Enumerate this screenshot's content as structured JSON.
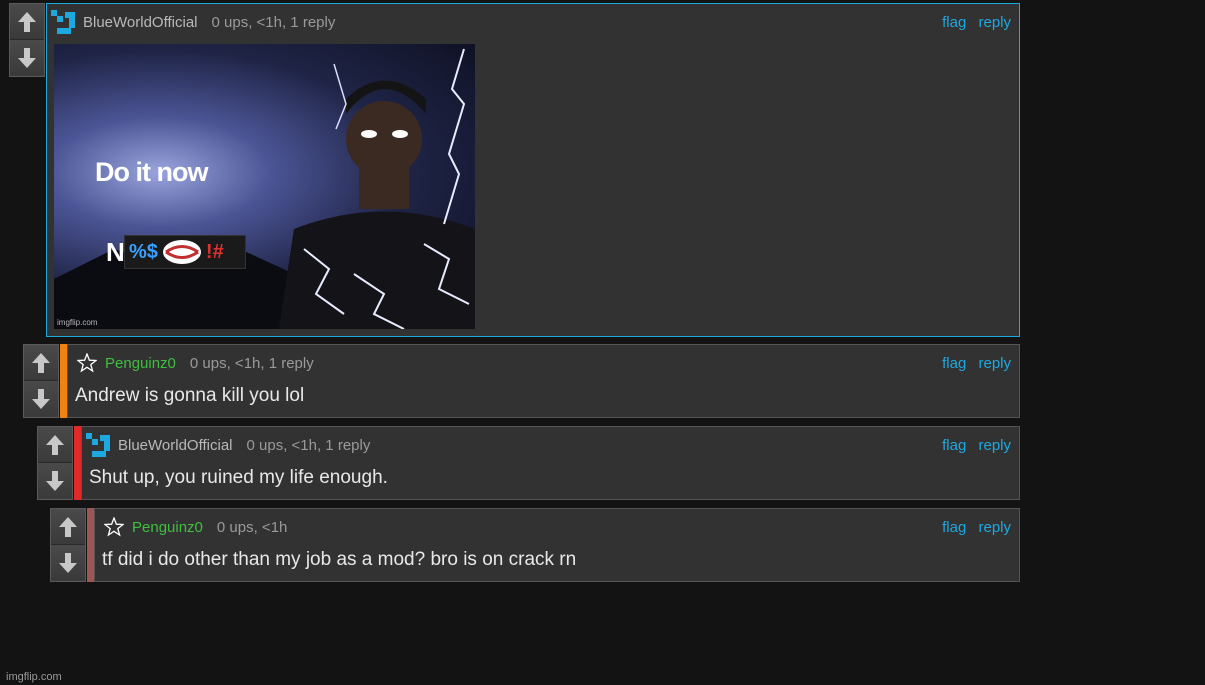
{
  "comments": [
    {
      "username": "BlueWorldOfficial",
      "meta": "0 ups, <1h, 1 reply",
      "flag": "flag",
      "reply": "reply",
      "image": {
        "text_line1": "Do it now",
        "text_letter": "N",
        "censor_symbols": "%$",
        "censor_symbols_end": "!#",
        "watermark": "imgflip.com"
      }
    },
    {
      "username": "Penguinz0",
      "meta": "0 ups, <1h, 1 reply",
      "flag": "flag",
      "reply": "reply",
      "text": "Andrew is gonna kill you lol",
      "accent_color": "#f0820f"
    },
    {
      "username": "BlueWorldOfficial",
      "meta": "0 ups, <1h, 1 reply",
      "flag": "flag",
      "reply": "reply",
      "text": "Shut up, you ruined my life enough.",
      "accent_color": "#e02a2a"
    },
    {
      "username": "Penguinz0",
      "meta": "0 ups, <1h",
      "flag": "flag",
      "reply": "reply",
      "text": "tf did i do other than my job as a mod? bro is on crack rn",
      "accent_color": "#a05555"
    }
  ],
  "colors": {
    "link": "#1ea8e0",
    "mod_green": "#3fbf3f",
    "background": "#131313"
  },
  "footer": {
    "watermark": "imgflip.com"
  }
}
